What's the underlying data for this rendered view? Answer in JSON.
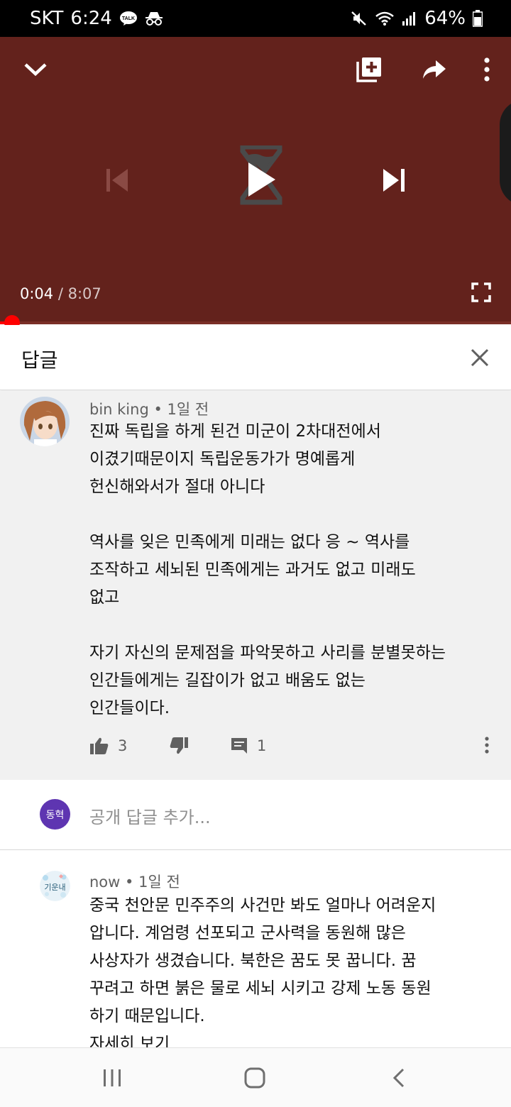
{
  "status_bar": {
    "carrier": "SKT",
    "time": "6:24",
    "talk_badge": "TALK",
    "battery": "64%"
  },
  "player": {
    "current_time": "0:04",
    "separator": " / ",
    "duration": "8:07",
    "progress_fraction": 0.008,
    "background_color": "#63221c"
  },
  "replies_panel": {
    "title": "답글"
  },
  "comment": {
    "author": "bin king",
    "time_ago": "• 1일 전",
    "lines": [
      "진짜 독립을 하게 된건 미군이 2차대전에서",
      "이겼기때문이지 독립운동가가 명예롭게",
      "헌신해와서가 절대 아니다",
      "",
      "역사를 잊은 민족에게 미래는 없다 응 ~ 역사를",
      "조작하고 세뇌된 민족에게는 과거도 없고 미래도",
      "없고",
      "",
      "자기 자신의 문제점을 파악못하고 사리를 분별못하는",
      "인간들에게는 길잡이가 없고 배움도 없는",
      "인간들이다."
    ],
    "like_count": "3",
    "reply_count": "1"
  },
  "add_reply": {
    "user_initials": "동혁",
    "placeholder": "공개 답글 추가..."
  },
  "reply": {
    "author": "now",
    "time_ago": "• 1일 전",
    "avatar_text": "기운내",
    "lines": [
      "중국 천안문  민주주의 사건만 봐도 얼마나 어려운지",
      "압니다. 계엄령 선포되고 군사력을 동원해 많은",
      "사상자가  생겼습니다. 북한은 꿈도 못 꿉니다. 꿈",
      "꾸려고 하면  붉은 물로 세뇌 시키고 강제 노동 동원",
      "하기 때문입니다."
    ],
    "read_more": "자세히 보기"
  }
}
